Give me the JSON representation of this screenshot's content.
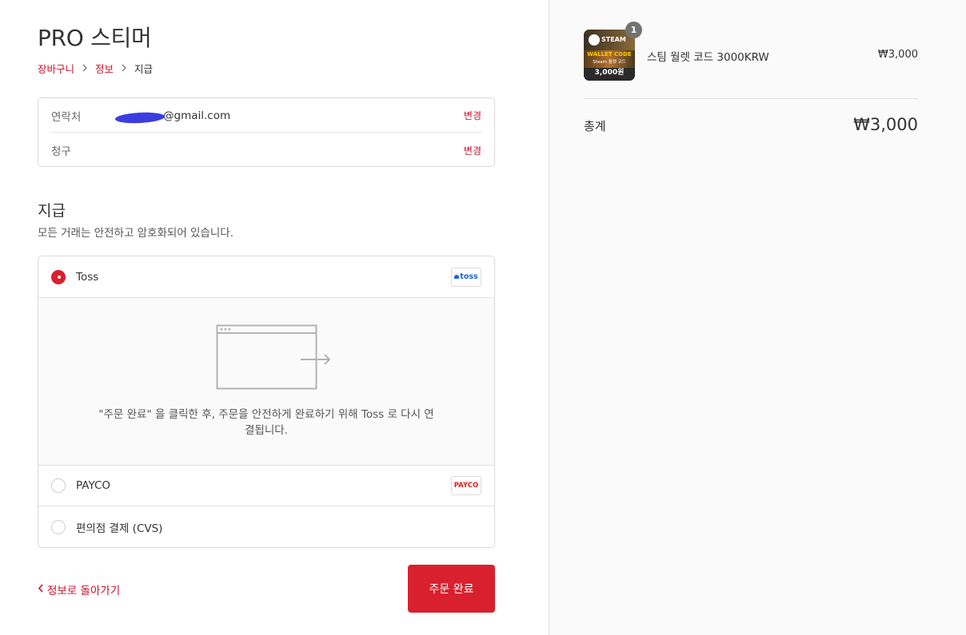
{
  "header": {
    "shop_title": "PRO 스티머"
  },
  "breadcrumb": {
    "items": [
      "장바구니",
      "정보",
      "지급"
    ]
  },
  "review": {
    "contact_label": "연락처",
    "contact_value": "@gmail.com",
    "billing_label": "청구",
    "change_label": "변경"
  },
  "payment": {
    "title": "지급",
    "subtitle": "모든 거래는 안전하고 암호화되어 있습니다.",
    "options": [
      {
        "name": "Toss",
        "logo_text": "toss",
        "selected": true
      },
      {
        "name": "PAYCO",
        "logo_text": "PAYCO",
        "selected": false
      },
      {
        "name": "편의점 결제 (CVS)",
        "selected": false
      }
    ],
    "redirect_text": "\"주문 완료\" 을 클릭한 후, 주문을 안전하게 완료하기 위해 Toss 로 다시 연결됩니다."
  },
  "footer": {
    "back_label": "정보로 돌아가기",
    "complete_label": "주문 완료"
  },
  "summary": {
    "item": {
      "name": "스팀 월렛 코드 3000KRW",
      "price": "₩3,000",
      "quantity": "1",
      "thumb_brand": "STEAM",
      "thumb_line1": "WALLET CODE",
      "thumb_line2": "Steam 월렛 코드",
      "thumb_price": "3,000원"
    },
    "total_label": "총계",
    "total_value": "₩3,000"
  },
  "colors": {
    "accent": "#d9202e",
    "link": "#c8102e",
    "sidebar_bg": "#fafafa"
  }
}
